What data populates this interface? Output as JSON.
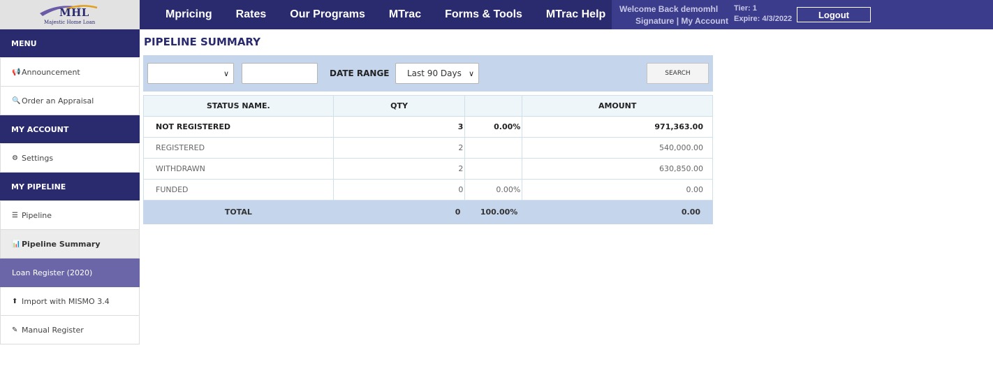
{
  "header": {
    "logo": {
      "name": "MHL",
      "sub": "Majestic Home Loan"
    },
    "nav": [
      "Mpricing",
      "Rates",
      "Our Programs",
      "MTrac",
      "Forms & Tools",
      "MTrac Help"
    ],
    "welcome": "Welcome Back demomhl",
    "signature": "Signature",
    "separator": "|",
    "my_account": "My Account",
    "tier": "Tier: 1",
    "expire": "Expire: 4/3/2022",
    "logout": "Logout"
  },
  "sidebar": {
    "sections": [
      {
        "title": "MENU",
        "items": [
          {
            "icon": "bullhorn-icon",
            "glyph": "📢",
            "label": "Announcement"
          },
          {
            "icon": "search-icon",
            "glyph": "🔍",
            "label": "Order an Appraisal"
          }
        ]
      },
      {
        "title": "MY ACCOUNT",
        "items": [
          {
            "icon": "gear-icon",
            "glyph": "⚙",
            "label": "Settings"
          }
        ]
      },
      {
        "title": "MY PIPELINE",
        "items": [
          {
            "icon": "list-icon",
            "glyph": "☰",
            "label": "Pipeline"
          },
          {
            "icon": "bar-chart-icon",
            "glyph": "📊",
            "label": "Pipeline Summary"
          },
          {
            "icon": "",
            "glyph": "",
            "label": "Loan Register (2020)"
          },
          {
            "icon": "upload-icon",
            "glyph": "⬆",
            "label": "Import with MISMO 3.4"
          },
          {
            "icon": "edit-icon",
            "glyph": "✎",
            "label": "Manual Register"
          }
        ]
      }
    ]
  },
  "main": {
    "title": "PIPELINE SUMMARY",
    "filters": {
      "status_select": "",
      "text_input": "",
      "date_range_label": "DATE RANGE",
      "date_range_value": "Last 90 Days",
      "search_label": "SEARCH"
    },
    "table": {
      "headers": [
        "STATUS NAME.",
        "QTY",
        "",
        "AMOUNT"
      ],
      "rows": [
        {
          "status": "NOT REGISTERED",
          "qty": "3",
          "pct": "0.00%",
          "amount": "971,363.00"
        },
        {
          "status": "REGISTERED",
          "qty": "2",
          "pct": "",
          "amount": "540,000.00"
        },
        {
          "status": "WITHDRAWN",
          "qty": "2",
          "pct": "",
          "amount": "630,850.00"
        },
        {
          "status": "FUNDED",
          "qty": "0",
          "pct": "0.00%",
          "amount": "0.00"
        }
      ],
      "total": {
        "label": "TOTAL",
        "qty": "0",
        "pct": "100.00%",
        "amount": "0.00"
      }
    }
  },
  "colors": {
    "nav_bg": "#2a2a6e",
    "welcome_bg": "#3c3c8c",
    "filter_bg": "#c5d6ec",
    "loan_register_bg": "#6a66a8"
  }
}
